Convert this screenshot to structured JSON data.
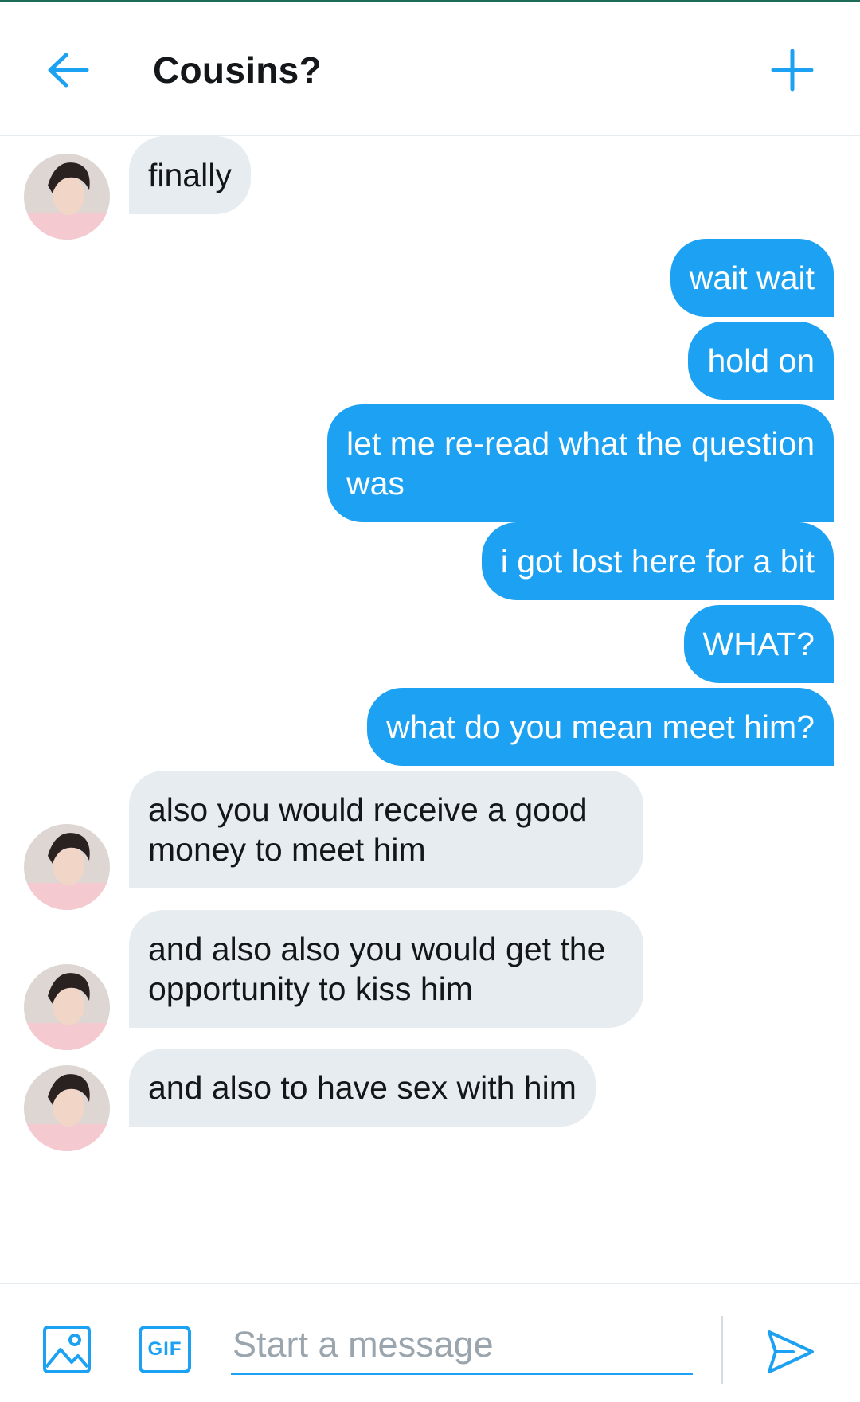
{
  "header": {
    "back_icon": "arrow-left-icon",
    "title": "Cousins?",
    "add_icon": "plus-icon"
  },
  "messages": [
    {
      "from": "them",
      "text": "finally"
    },
    {
      "from": "me",
      "text": "wait wait"
    },
    {
      "from": "me",
      "text": "hold on"
    },
    {
      "from": "me",
      "text": "let me re-read what the question\nwas"
    },
    {
      "from": "me",
      "text": "i got lost here for a bit"
    },
    {
      "from": "me",
      "text": "WHAT?"
    },
    {
      "from": "me",
      "text": "what do you mean meet him?"
    },
    {
      "from": "them",
      "text": "also you would receive a good\nmoney to meet him"
    },
    {
      "from": "them",
      "text": "and also also you would get the\nopportunity to kiss him"
    },
    {
      "from": "them",
      "text": "and also to have sex with him"
    }
  ],
  "composer": {
    "image_icon": "image-icon",
    "gif_label": "GIF",
    "placeholder": "Start a message",
    "value": "",
    "send_icon": "send-icon"
  },
  "colors": {
    "accent": "#1da1f2",
    "incoming_bubble": "#e6ecf0",
    "text": "#14171a"
  }
}
